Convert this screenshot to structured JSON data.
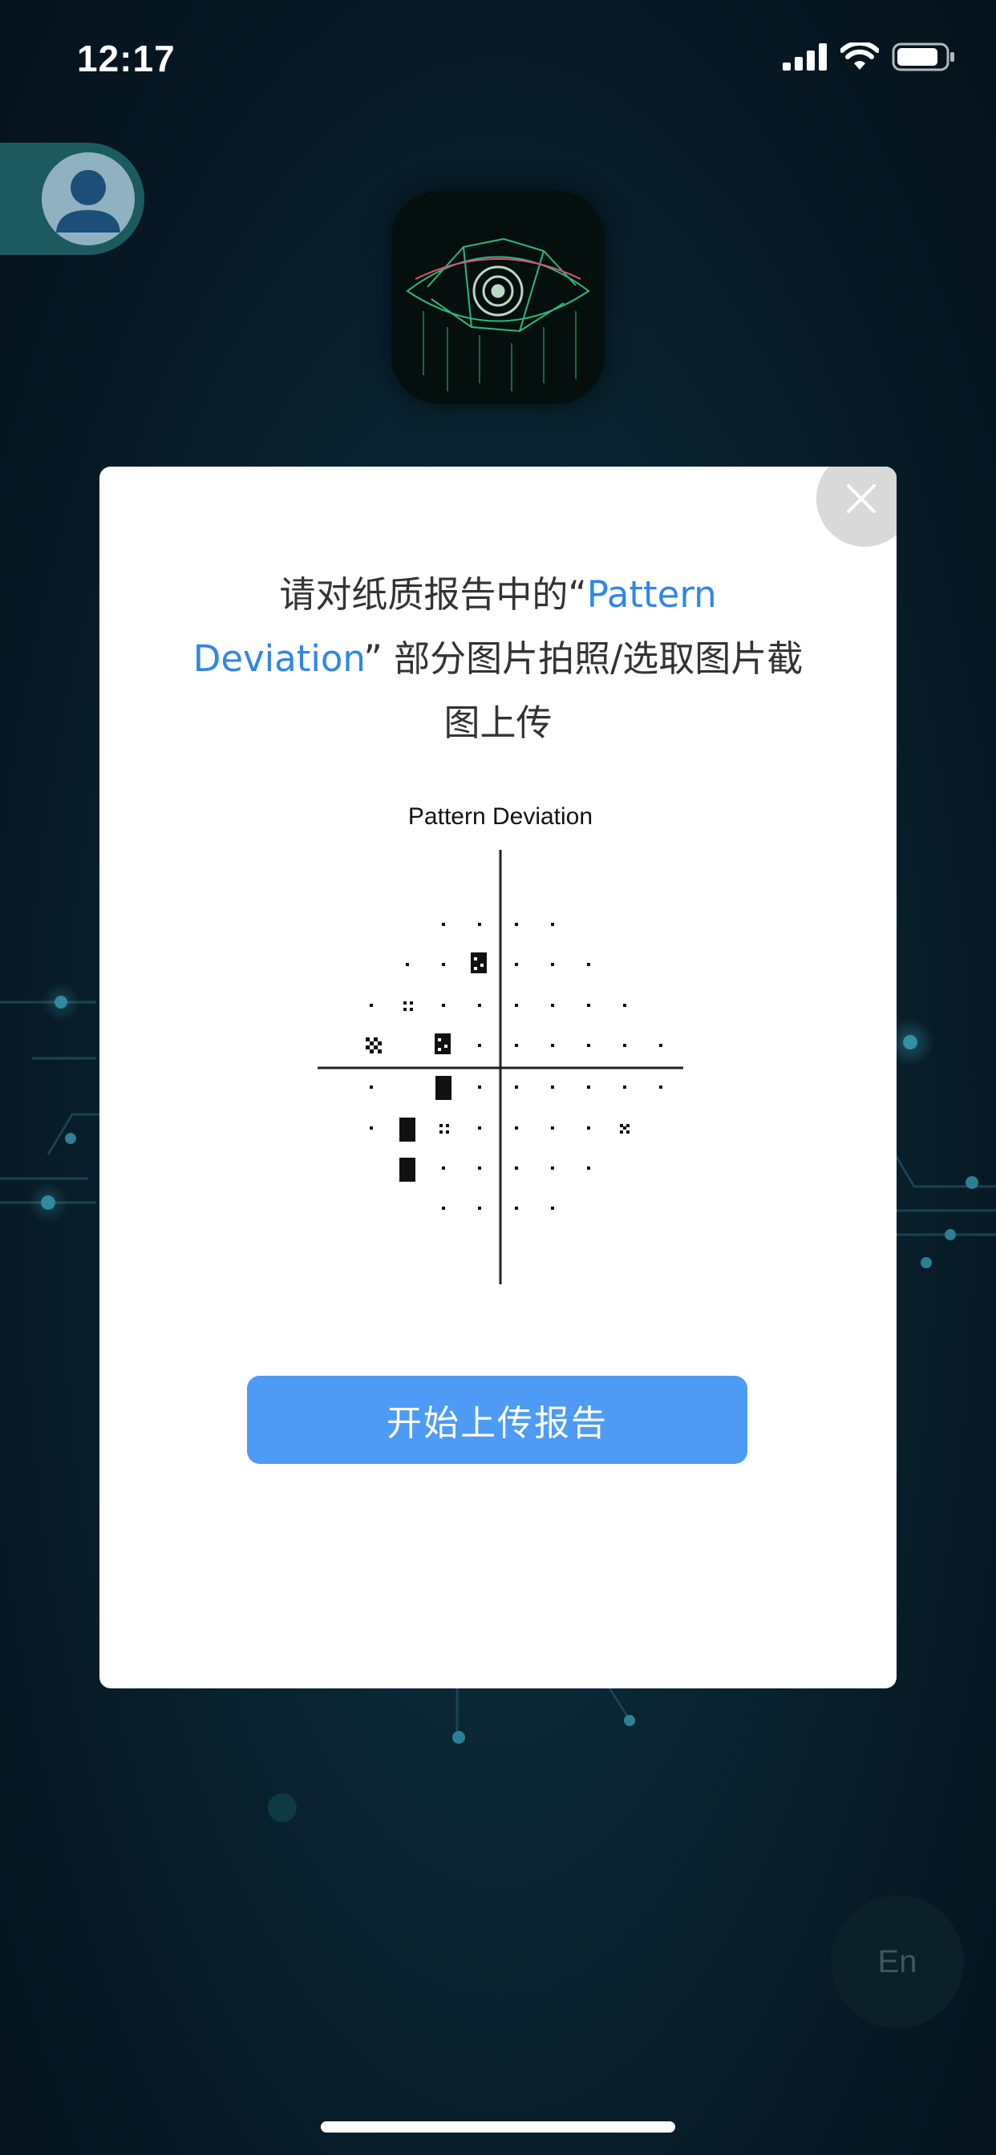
{
  "status_bar": {
    "time": "12:17"
  },
  "modal": {
    "instruction_prefix": "请对纸质报告中的“",
    "instruction_highlight": "Pattern Deviation",
    "instruction_suffix": "” 部分图片拍照/选取图片截图上传",
    "figure_title": "Pattern Deviation",
    "primary_button": "开始上传报告",
    "close_icon": "close-icon"
  },
  "language_toggle": "En",
  "colors": {
    "accent": "#4d9bf5",
    "highlight_text": "#2f86e8",
    "modal_bg": "#ffffff"
  }
}
